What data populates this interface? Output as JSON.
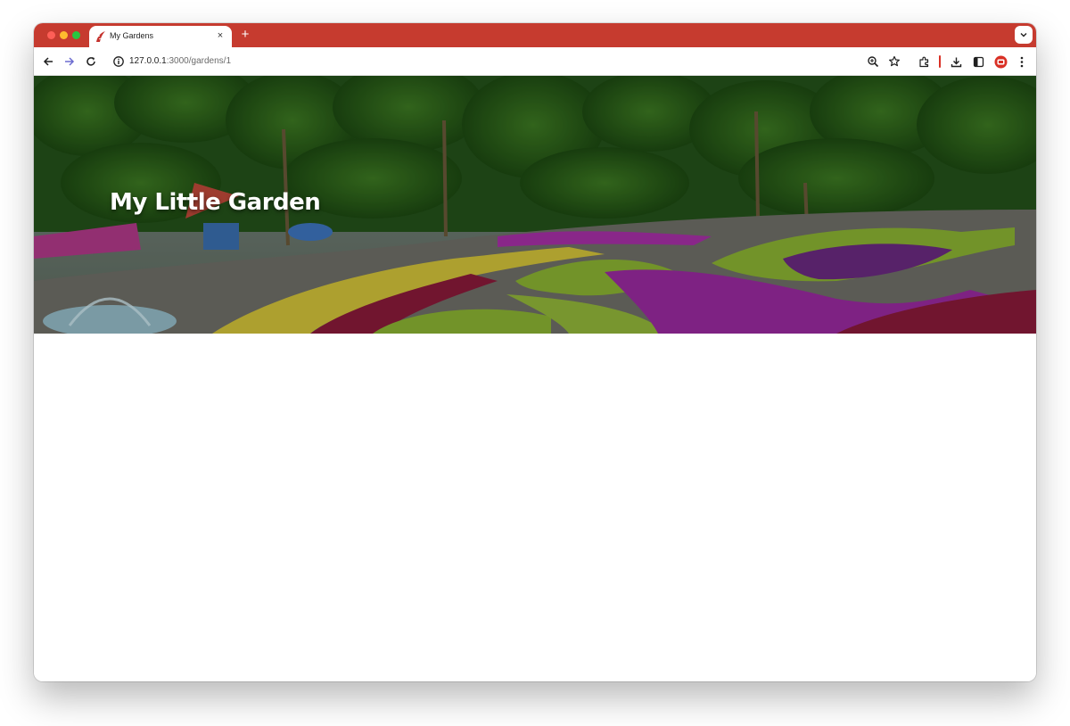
{
  "browser": {
    "tab": {
      "title": "My Gardens",
      "close_label": "×",
      "favicon": "ruby-rails-icon"
    },
    "new_tab_label": "+",
    "tab_search_icon": "chevron-down-icon",
    "nav": {
      "back_icon": "arrow-left-icon",
      "forward_icon": "arrow-right-icon",
      "reload_icon": "reload-icon"
    },
    "address": {
      "host": "127.0.0.1",
      "path": ":3000/gardens/1",
      "site_info_icon": "info-icon"
    },
    "toolbar_icons": [
      "zoom-icon",
      "bookmark-star-icon",
      "extensions-icon",
      "download-icon",
      "side-panel-icon",
      "profile-icon",
      "more-menu-icon"
    ],
    "colors": {
      "tabbar": "#c63b2f",
      "divider": "#d93025"
    }
  },
  "page": {
    "hero": {
      "title": "My Little Garden"
    }
  }
}
